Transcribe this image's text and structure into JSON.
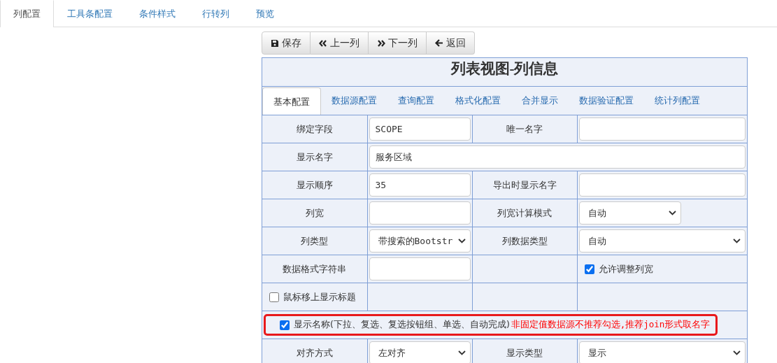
{
  "top_tabs": [
    {
      "label": "列配置",
      "selected": true
    },
    {
      "label": "工具条配置",
      "selected": false
    },
    {
      "label": "条件样式",
      "selected": false
    },
    {
      "label": "行转列",
      "selected": false
    },
    {
      "label": "预览",
      "selected": false
    }
  ],
  "toolbar": [
    {
      "kind": "save",
      "label": "保存"
    },
    {
      "kind": "previous",
      "label": "上一列"
    },
    {
      "kind": "next",
      "label": "下一列"
    },
    {
      "kind": "back",
      "label": "返回"
    }
  ],
  "panel": {
    "title": "列表视图-列信息",
    "tabs": [
      {
        "label": "基本配置",
        "selected": true
      },
      {
        "label": "数据源配置",
        "selected": false
      },
      {
        "label": "查询配置",
        "selected": false
      },
      {
        "label": "格式化配置",
        "selected": false
      },
      {
        "label": "合并显示",
        "selected": false
      },
      {
        "label": "数据验证配置",
        "selected": false
      },
      {
        "label": "统计列配置",
        "selected": false
      }
    ],
    "rows": [
      {
        "cells": [
          {
            "kind": "label",
            "text": "绑定字段"
          },
          {
            "kind": "input",
            "value": "SCOPE"
          },
          {
            "kind": "label",
            "text": "唯一名字"
          },
          {
            "kind": "input"
          }
        ]
      },
      {
        "cells": [
          {
            "kind": "label",
            "text": "显示名字"
          },
          {
            "kind": "input",
            "value": "服务区域",
            "colspan": 3
          }
        ]
      },
      {
        "cells": [
          {
            "kind": "label",
            "text": "显示顺序"
          },
          {
            "kind": "input",
            "value": "35"
          },
          {
            "kind": "label",
            "text": "导出时显示名字"
          },
          {
            "kind": "input"
          }
        ]
      },
      {
        "cells": [
          {
            "kind": "label",
            "text": "列宽"
          },
          {
            "kind": "input"
          },
          {
            "kind": "label",
            "text": "列宽计算模式"
          },
          {
            "kind": "compact-select",
            "value": "自动"
          }
        ]
      },
      {
        "cells": [
          {
            "kind": "label",
            "text": "列类型"
          },
          {
            "kind": "select",
            "value": "带搜索的Bootstr"
          },
          {
            "kind": "label",
            "text": "列数据类型"
          },
          {
            "kind": "select",
            "value": "自动"
          }
        ]
      },
      {
        "cells": [
          {
            "kind": "label",
            "text": "数据格式字符串"
          },
          {
            "kind": "input"
          },
          {
            "kind": "empty"
          },
          {
            "kind": "checkbox",
            "checked": true,
            "label": "允许调整列宽"
          }
        ]
      },
      {
        "cells": [
          {
            "kind": "checkbox",
            "checked": false,
            "label": "鼠标移上显示标题"
          },
          {
            "kind": "empty"
          },
          {
            "kind": "empty"
          },
          {
            "kind": "empty"
          }
        ]
      },
      {
        "cells": [
          {
            "kind": "notice",
            "colspan": 4,
            "checked": true,
            "highlighted": true,
            "label": "显示名称(下拉、复选、复选按钮组、单选、自动完成)",
            "warning": "非固定值数据源不推荐勾选,推荐join形式取名字"
          }
        ]
      },
      {
        "cells": [
          {
            "kind": "label",
            "text": "对齐方式"
          },
          {
            "kind": "select",
            "value": "左对齐"
          },
          {
            "kind": "label",
            "text": "显示类型"
          },
          {
            "kind": "select",
            "value": "显示"
          }
        ]
      }
    ]
  }
}
